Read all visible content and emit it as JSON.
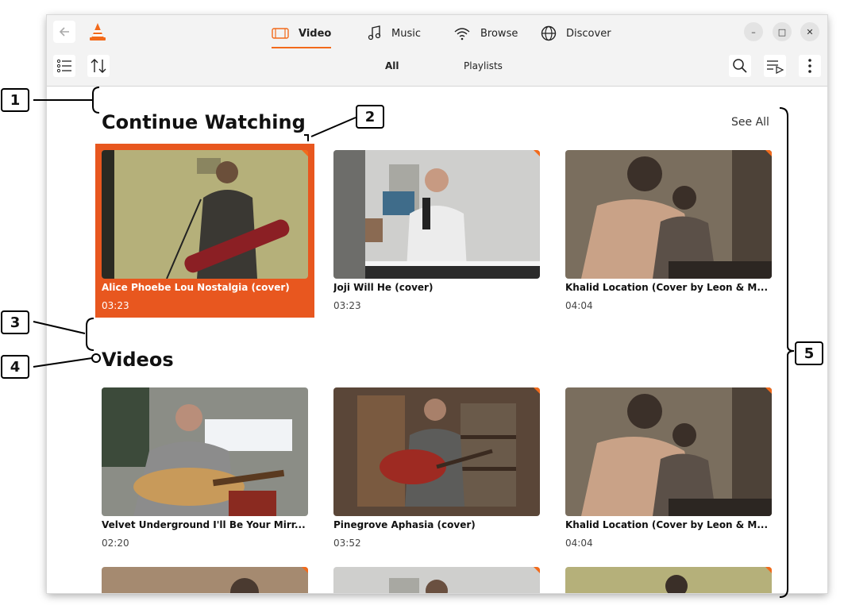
{
  "nav": {
    "tabs": [
      {
        "label": "Video",
        "icon": "film-icon",
        "active": true
      },
      {
        "label": "Music",
        "icon": "music-note-icon",
        "active": false
      },
      {
        "label": "Browse",
        "icon": "wifi-icon",
        "active": false
      },
      {
        "label": "Discover",
        "icon": "globe-icon",
        "active": false
      }
    ]
  },
  "subtabs": [
    {
      "label": "All",
      "active": true
    },
    {
      "label": "Playlists",
      "active": false
    }
  ],
  "continue_watching": {
    "title": "Continue Watching",
    "see_all": "See All",
    "items": [
      {
        "title": "Alice Phoebe Lou Nostalgia (cover)",
        "duration": "03:23",
        "selected": true
      },
      {
        "title": "Joji Will He (cover)",
        "duration": "03:23",
        "selected": false
      },
      {
        "title": "Khalid Location (Cover by Leon & M...",
        "duration": "04:04",
        "selected": false
      }
    ]
  },
  "videos": {
    "title": "Videos",
    "items": [
      {
        "title": "Velvet Underground I'll Be Your Mirr...",
        "duration": "02:20"
      },
      {
        "title": "Pinegrove Aphasia (cover)",
        "duration": "03:52"
      },
      {
        "title": "Khalid Location (Cover by Leon & M...",
        "duration": "04:04"
      }
    ]
  },
  "annotations": [
    "1",
    "2",
    "3",
    "4",
    "5"
  ],
  "colors": {
    "accent": "#f26a1b",
    "selected": "#e8571f"
  }
}
